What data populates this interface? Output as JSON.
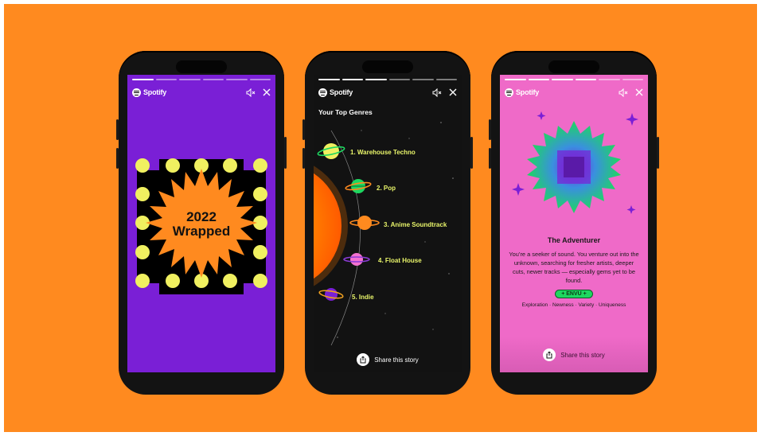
{
  "background_color": "#ff8a1f",
  "brand": {
    "name": "Spotify"
  },
  "icons": {
    "mute": "mute-icon",
    "close": "close-icon",
    "share": "share-icon",
    "logo": "spotify-logo-icon"
  },
  "phones": [
    {
      "screen_color": "#7a1fd6",
      "progress": {
        "segments": 6,
        "active": 1
      },
      "headline_line1": "2022",
      "headline_line2": "Wrapped"
    },
    {
      "screen_color": "#121212",
      "progress": {
        "segments": 6,
        "active": 3
      },
      "heading": "Your Top Genres",
      "genres": [
        {
          "rank": "1.",
          "name": "Warehouse Techno",
          "label": "1.  Warehouse Techno"
        },
        {
          "rank": "2.",
          "name": "Pop",
          "label": "2.  Pop"
        },
        {
          "rank": "3.",
          "name": "Anime Soundtrack",
          "label": "3.  Anime Soundtrack"
        },
        {
          "rank": "4.",
          "name": "Float House",
          "label": "4.  Float House"
        },
        {
          "rank": "5.",
          "name": "Indie",
          "label": "5.  Indie"
        }
      ],
      "share_label": "Share this story"
    },
    {
      "screen_color": "#ef6ac8",
      "progress": {
        "segments": 6,
        "active": 4
      },
      "title": "The Adventurer",
      "description": "You’re a seeker of sound. You venture out into the unknown, searching for fresher artists, deeper cuts, newer tracks — especially gems yet to be found.",
      "badge": "+ ENVU +",
      "tags": "Exploration · Newness · Variety · Uniqueness",
      "share_label": "Share this story"
    }
  ]
}
